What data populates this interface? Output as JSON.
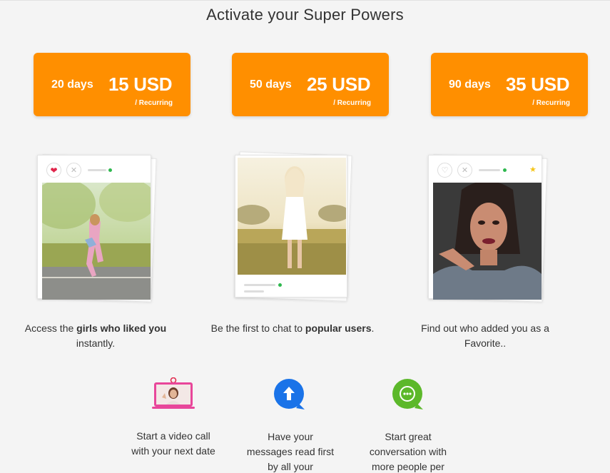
{
  "page": {
    "title": "Activate your Super Powers"
  },
  "plans": [
    {
      "days": "20 days",
      "price": "15 USD",
      "recurring": "/ Recurring"
    },
    {
      "days": "50 days",
      "price": "25 USD",
      "recurring": "/ Recurring"
    },
    {
      "days": "90 days",
      "price": "35 USD",
      "recurring": "/ Recurring"
    }
  ],
  "features": [
    {
      "before": "Access the ",
      "bold": "girls who liked you",
      "after": " instantly."
    },
    {
      "before": "Be the first to chat to ",
      "bold": "popular users",
      "after": "."
    },
    {
      "before": "Find out who added you as a Favorite..",
      "bold": "",
      "after": ""
    }
  ],
  "extras": [
    {
      "text": "Start a video call with your next date",
      "icon": "video-call-icon"
    },
    {
      "text": "Have your messages read first by all your",
      "icon": "arrow-up-icon"
    },
    {
      "text": "Start great conversation with more people per",
      "icon": "chat-bubble-icon"
    }
  ],
  "colors": {
    "accent": "#ff8f00",
    "online": "#2fb84f",
    "heart": "#e0244a",
    "upload_blue": "#1a73e8",
    "chat_green": "#5cb82a"
  }
}
